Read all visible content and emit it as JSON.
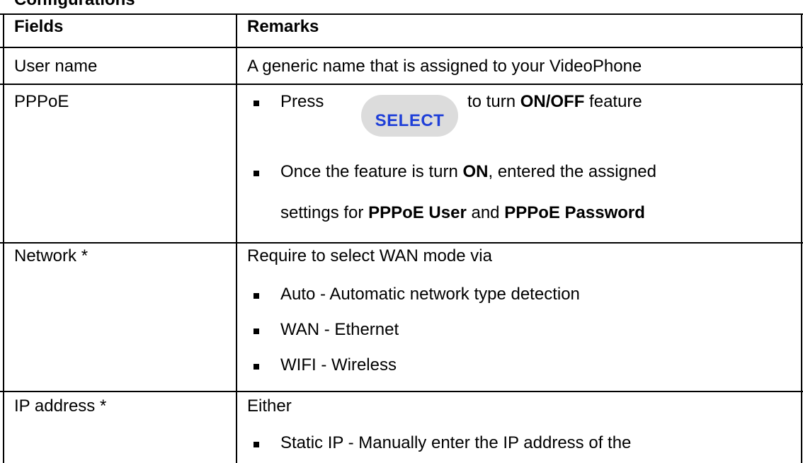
{
  "section": {
    "title": "Configurations"
  },
  "table": {
    "headers": [
      "Fields",
      "Remarks"
    ],
    "rows": [
      {
        "field": "User name",
        "remark": "A generic name that is assigned to your VideoPhone"
      },
      {
        "field": "PPPoE",
        "bullet1": {
          "pre": "Press",
          "key": "SELECT",
          "mid": "to turn",
          "bold": "ON/OFF",
          "post": "feature"
        },
        "bullet2": {
          "line1_pre": "Once the feature is turn",
          "line1_bold": "ON",
          "line1_post": ", entered the assigned",
          "line2_pre": "settings for",
          "line2_bold1": "PPPoE User",
          "line2_mid": "and",
          "line2_bold2": "PPPoE Password"
        }
      },
      {
        "field": "Network *",
        "intro": "Require to select WAN mode via",
        "options": [
          "Auto - Automatic network type detection",
          "WAN - Ethernet",
          "WIFI - Wireless"
        ]
      },
      {
        "field": "IP address *",
        "intro": "Either",
        "option1": "Static IP - Manually enter the IP address of the"
      }
    ]
  }
}
